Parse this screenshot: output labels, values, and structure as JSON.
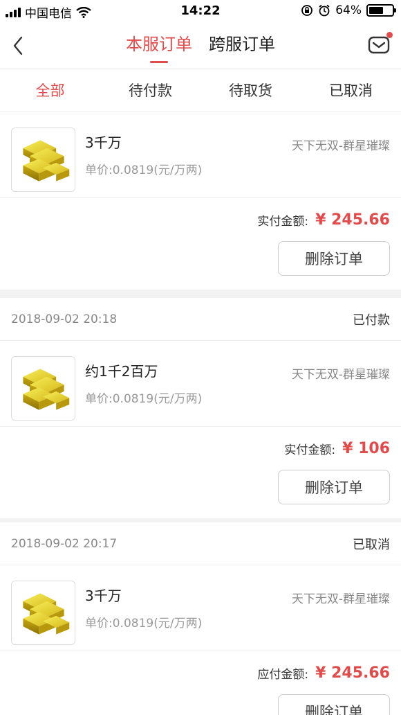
{
  "status_bar": {
    "carrier": "中国电信",
    "time": "14:22",
    "battery": "64%",
    "battery_level": 0.64
  },
  "nav": {
    "tabs": [
      {
        "label": "本服订单",
        "active": true
      },
      {
        "label": "跨服订单",
        "active": false
      }
    ]
  },
  "filter_tabs": [
    {
      "label": "全部",
      "active": true
    },
    {
      "label": "待付款",
      "active": false
    },
    {
      "label": "待取货",
      "active": false
    },
    {
      "label": "已取消",
      "active": false
    }
  ],
  "orders": [
    {
      "date": "",
      "status": "",
      "product_name": "3千万",
      "unit_price": "单价:0.0819(元/万两)",
      "server": "天下无双-群星璀璨",
      "pay_label": "实付金额:",
      "pay_amount": "¥ 245.66",
      "button": "删除订单"
    },
    {
      "date": "2018-09-02 20:18",
      "status": "已付款",
      "product_name": "约1千2百万",
      "unit_price": "单价:0.0819(元/万两)",
      "server": "天下无双-群星璀璨",
      "pay_label": "实付金额:",
      "pay_amount": "¥ 106",
      "button": "删除订单"
    },
    {
      "date": "2018-09-02 20:17",
      "status": "已取消",
      "product_name": "3千万",
      "unit_price": "单价:0.0819(元/万两)",
      "server": "天下无双-群星璀璨",
      "pay_label": "应付金额:",
      "pay_amount": "¥ 245.66",
      "button": "删除订单"
    }
  ],
  "colors": {
    "accent": "#e04b4b",
    "background": "#f2f2f2"
  }
}
